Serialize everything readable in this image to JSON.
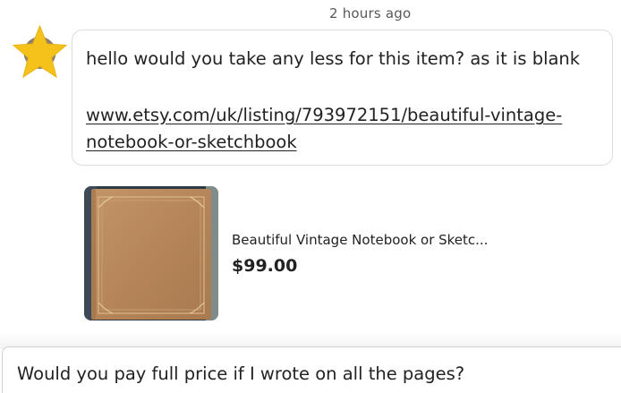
{
  "conversation": {
    "timestamp": "2 hours ago",
    "sender_avatar_icon": "star-icon",
    "message": {
      "text": "hello would you take any less for this item? as it is blank",
      "link": "www.etsy.com/uk/listing/793972151/beautiful-vintage-notebook-or-sketchbook"
    },
    "listing": {
      "title": "Beautiful Vintage Notebook or Sketc...",
      "price": "$99.00"
    }
  },
  "composer": {
    "draft": "Would you pay full price if I wrote on all the pages?"
  },
  "colors": {
    "star": "#f5c21b",
    "notebook_leather": "#b98a5c",
    "bubble_border": "#dddddd"
  }
}
